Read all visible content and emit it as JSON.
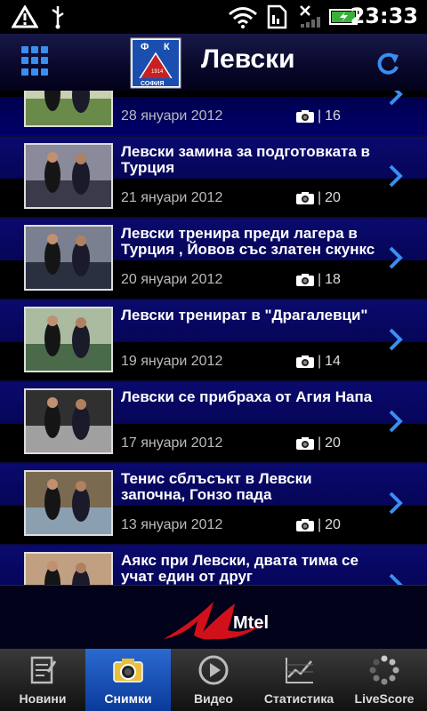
{
  "status_bar": {
    "time": "23:33",
    "icons": [
      "warning-icon",
      "usb-icon",
      "wifi-icon",
      "sim-icon",
      "signal-off-icon",
      "battery-charging-icon"
    ]
  },
  "header": {
    "title": "Левски",
    "logo_letters": [
      "Ф",
      "К",
      "СОФИЯ"
    ],
    "logo_year": "1914",
    "accent": "#3a8ef0"
  },
  "gallery": {
    "items": [
      {
        "title": "",
        "date": "28 януари 2012",
        "count": "16"
      },
      {
        "title": "Левски замина за подготовката в Турция",
        "date": "21 януари 2012",
        "count": "20"
      },
      {
        "title": "Левски тренира преди лагера в Турция , Йовов със златен скункс",
        "date": "20 януари 2012",
        "count": "18"
      },
      {
        "title": "Левски тренират в \"Драгалевци\"",
        "date": "19 януари 2012",
        "count": "14"
      },
      {
        "title": "Левски се прибраха от Агия Напа",
        "date": "17 януари 2012",
        "count": "20"
      },
      {
        "title": "Тенис сблъсъкт в Левски започна, Гонзо пада",
        "date": "13 януари 2012",
        "count": "20"
      },
      {
        "title": "Аякс при Левски, двата тима се учат един от друг",
        "date": "",
        "count": ""
      }
    ],
    "count_separator": "|"
  },
  "ad": {
    "brand": "Mtel"
  },
  "tabs": [
    {
      "label": "Новини",
      "icon": "news-icon"
    },
    {
      "label": "Снимки",
      "icon": "camera-icon"
    },
    {
      "label": "Видео",
      "icon": "play-icon"
    },
    {
      "label": "Статистика",
      "icon": "chart-icon"
    },
    {
      "label": "LiveScore",
      "icon": "spinner-icon"
    }
  ]
}
